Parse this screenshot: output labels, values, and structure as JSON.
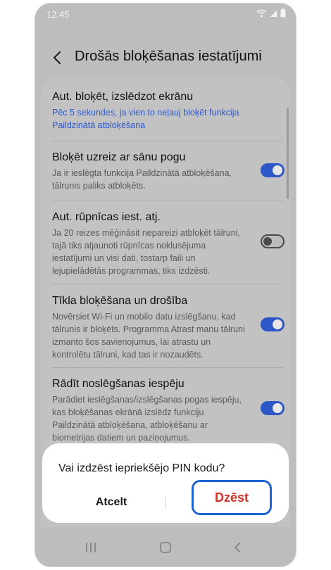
{
  "status_bar": {
    "time": "12:45",
    "icons": [
      "wifi-icon",
      "signal-icon",
      "battery-icon"
    ]
  },
  "header": {
    "title": "Drošās bloķēšanas iestatījumi",
    "back_icon": "chevron-left-icon"
  },
  "settings": [
    {
      "title": "Aut. bloķēt, izslēdzot ekrānu",
      "description": "Pēc 5 sekundes, ja vien to neļauj bloķēt funkcija Paildzinātā atbloķēšana",
      "description_color": "#2e59d0"
    },
    {
      "title": "Bloķēt uzreiz ar sānu pogu",
      "description": "Ja ir ieslēgta funkcija Paildzinātā atbloķēšana, tālrunis paliks atbloķēts.",
      "toggle_on": true
    },
    {
      "title": "Aut. rūpnīcas iest. atj.",
      "description": "Ja 20 reizes mēģināsit nepareizi atbloķēt tālruni, tajā tiks atjaunoti rūpnīcas noklusējuma iestatījumi un visi dati, tostarp faili un lejupielādētās programmas, tiks izdzēsti.",
      "toggle_on": false
    },
    {
      "title": "Tīkla bloķēšana un drošība",
      "description": "Novērsiet Wi-Fi un mobilo datu izslēgšanu, kad tālrunis ir bloķēts. Programma Atrast manu tālruni izmanto šos savienojumus, lai atrastu un kontrolētu tālruni, kad tas ir nozaudēts.",
      "toggle_on": true
    },
    {
      "title": "Rādīt noslēgšanas iespēju",
      "description": "Parādiet ieslēgšanas/izslēgšanas pogas iespēju, kas bloķēšanas ekrānā izslēdz funkciju Paildzinātā atbloķēšana, atbloķēšanu ar biometrijas datiem un paziņojumus.",
      "toggle_on": true
    }
  ],
  "dialog": {
    "message": "Vai izdzēst iepriekšējo PIN kodu?",
    "cancel_label": "Atcelt",
    "delete_label": "Dzēst",
    "delete_color": "#d2332a",
    "highlight_color": "#1d63d3"
  },
  "nav_bar": {
    "icons": [
      "recents-icon",
      "home-icon",
      "back-icon"
    ]
  },
  "colors": {
    "toggle_on": "#2d56c6",
    "overlay_background": "#bdbdbd"
  }
}
